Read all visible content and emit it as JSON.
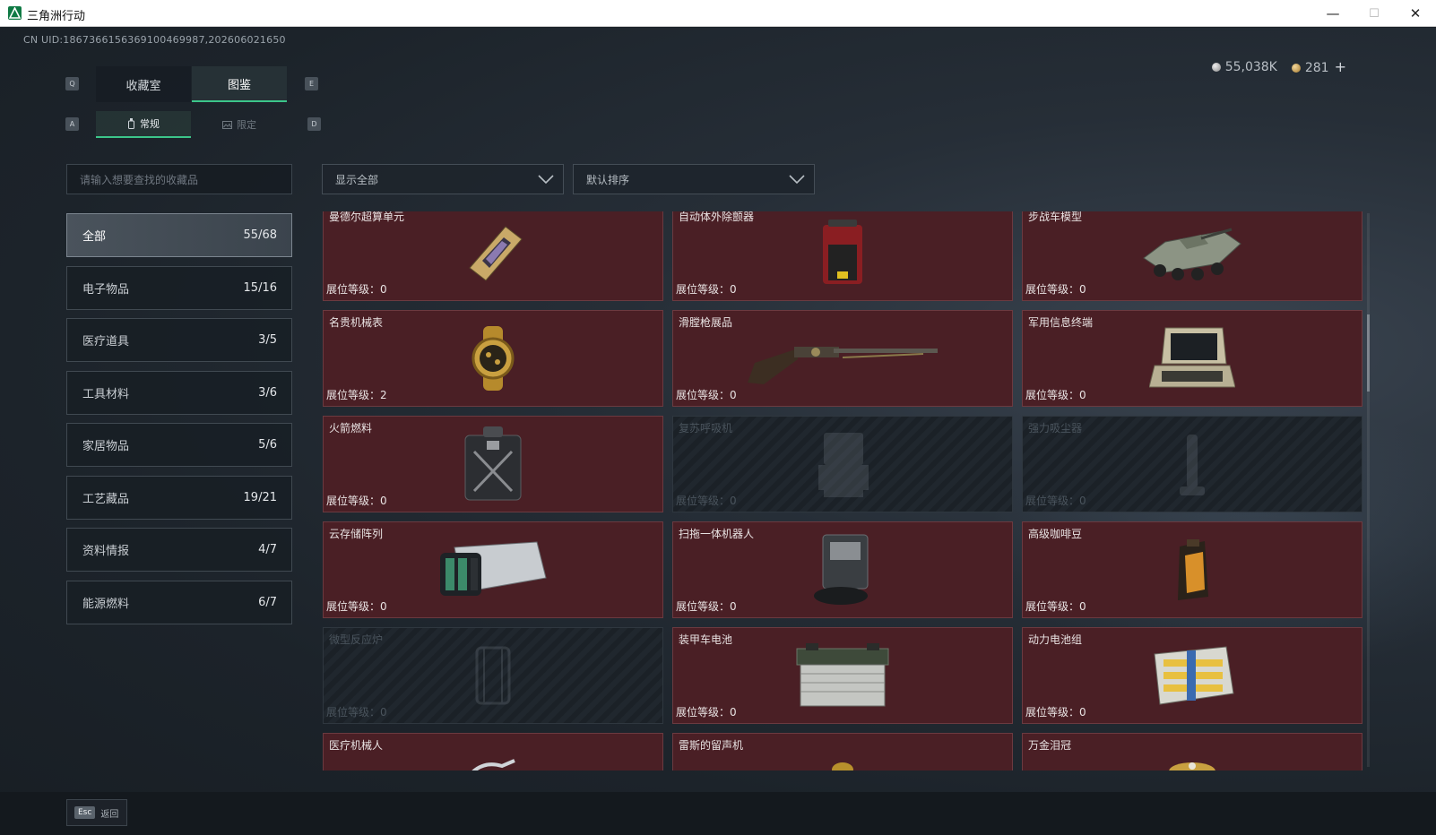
{
  "window": {
    "title": "三角洲行动",
    "minimize": "—",
    "maximize": "☐",
    "close": "✕"
  },
  "uid": "CN UID:1867366156369100469987,202606021650",
  "currency": {
    "silver": "55,038K",
    "gold": "281",
    "add": "+"
  },
  "keys": {
    "prev_tab": "Q",
    "next_tab": "E",
    "prev_sub": "A",
    "next_sub": "D"
  },
  "tabs": [
    {
      "label": "收藏室"
    },
    {
      "label": "图鉴"
    }
  ],
  "subtabs": [
    {
      "label": "常规"
    },
    {
      "label": "限定"
    }
  ],
  "search": {
    "placeholder": "请输入想要查找的收藏品"
  },
  "filters": {
    "show": "显示全部",
    "sort": "默认排序"
  },
  "categories": [
    {
      "label": "全部",
      "count": "55/68"
    },
    {
      "label": "电子物品",
      "count": "15/16"
    },
    {
      "label": "医疗道具",
      "count": "3/5"
    },
    {
      "label": "工具材料",
      "count": "3/6"
    },
    {
      "label": "家居物品",
      "count": "5/6"
    },
    {
      "label": "工艺藏品",
      "count": "19/21"
    },
    {
      "label": "资料情报",
      "count": "4/7"
    },
    {
      "label": "能源燃料",
      "count": "6/7"
    }
  ],
  "level_label": "展位等级：",
  "items": [
    {
      "name": "曼德尔超算单元",
      "level": "0",
      "locked": false,
      "icon": "supercomputer-chip"
    },
    {
      "name": "自动体外除颤器",
      "level": "0",
      "locked": false,
      "icon": "defibrillator"
    },
    {
      "name": "步战车模型",
      "level": "0",
      "locked": false,
      "icon": "ifv-model"
    },
    {
      "name": "名贵机械表",
      "level": "2",
      "locked": false,
      "icon": "gold-watch"
    },
    {
      "name": "滑膛枪展品",
      "level": "0",
      "locked": false,
      "icon": "musket"
    },
    {
      "name": "军用信息终端",
      "level": "0",
      "locked": false,
      "icon": "military-terminal"
    },
    {
      "name": "火箭燃料",
      "level": "0",
      "locked": false,
      "icon": "fuel-can"
    },
    {
      "name": "复苏呼吸机",
      "level": "0",
      "locked": true,
      "icon": "ventilator"
    },
    {
      "name": "强力吸尘器",
      "level": "0",
      "locked": true,
      "icon": "vacuum-cleaner"
    },
    {
      "name": "云存储阵列",
      "level": "0",
      "locked": false,
      "icon": "storage-array"
    },
    {
      "name": "扫拖一体机器人",
      "level": "0",
      "locked": false,
      "icon": "robot-mop"
    },
    {
      "name": "高级咖啡豆",
      "level": "0",
      "locked": false,
      "icon": "coffee-bag"
    },
    {
      "name": "微型反应炉",
      "level": "0",
      "locked": true,
      "icon": "micro-reactor"
    },
    {
      "name": "装甲车电池",
      "level": "0",
      "locked": false,
      "icon": "armored-battery"
    },
    {
      "name": "动力电池组",
      "level": "0",
      "locked": false,
      "icon": "power-battery-pack"
    },
    {
      "name": "医疗机械人",
      "level": "",
      "locked": false,
      "icon": "medical-robot"
    },
    {
      "name": "雷斯的留声机",
      "level": "",
      "locked": false,
      "icon": "gramophone"
    },
    {
      "name": "万金泪冠",
      "level": "",
      "locked": false,
      "icon": "jeweled-crown"
    }
  ],
  "footer": {
    "esc_key": "Esc",
    "esc_label": "返回"
  },
  "colors": {
    "accent": "#3cc68a",
    "card_bg": "#4a1f25",
    "card_border": "#6b3a40"
  }
}
